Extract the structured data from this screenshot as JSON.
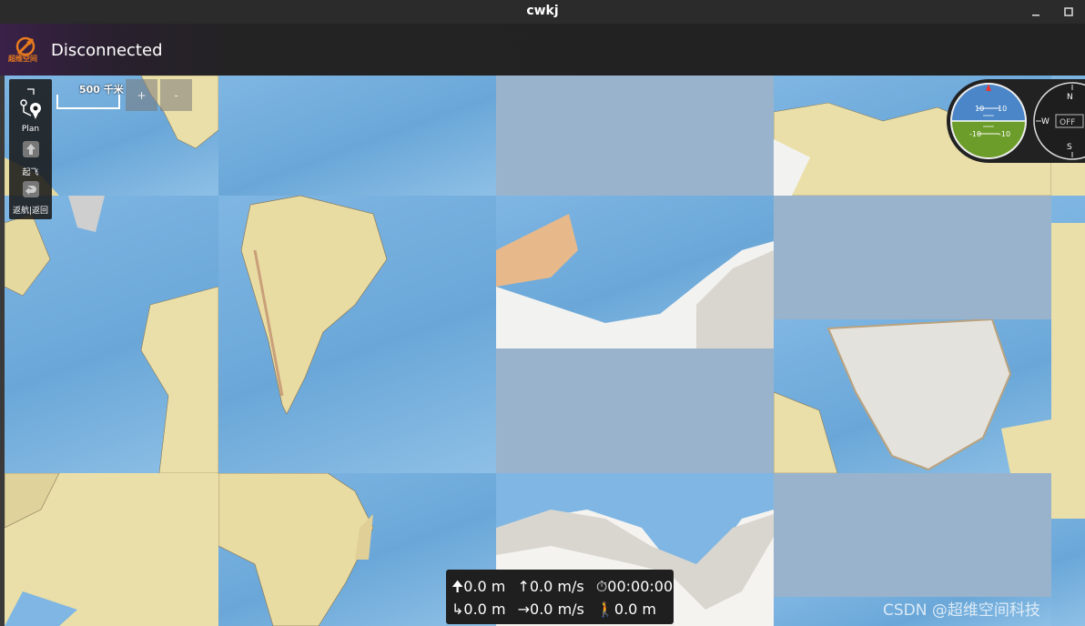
{
  "window": {
    "title": "cwkj",
    "min_icon": "minimize-icon",
    "max_icon": "maximize-icon"
  },
  "toolbar": {
    "status": "Disconnected",
    "logo_text": "超维空间"
  },
  "map": {
    "scale_label": "500 千米",
    "zoom_in": "+",
    "zoom_out": "-"
  },
  "tools": {
    "plan": "Plan",
    "takeoff": "起飞",
    "return": "返航|返回"
  },
  "attitude": {
    "pitch_up": "10",
    "pitch_up_r": "10",
    "pitch_down": "-10",
    "pitch_down_r": "-10"
  },
  "compass": {
    "n": "N",
    "w": "W",
    "s": "S",
    "off": "OFF"
  },
  "telemetry": {
    "altitude": "0.0 m",
    "climb_rate": "0.0 m/s",
    "flight_time": "00:00:00",
    "distance": "0.0 m",
    "ground_speed": "0.0 m/s",
    "home_distance": "0.0 m"
  },
  "watermark": "CSDN @超维空间科技",
  "colors": {
    "ocean": "#6aa7d8",
    "land": "#eadfa8",
    "ice": "#f2f2f0",
    "toolbar_accent": "#3a2148",
    "logo": "#e87a1e"
  }
}
